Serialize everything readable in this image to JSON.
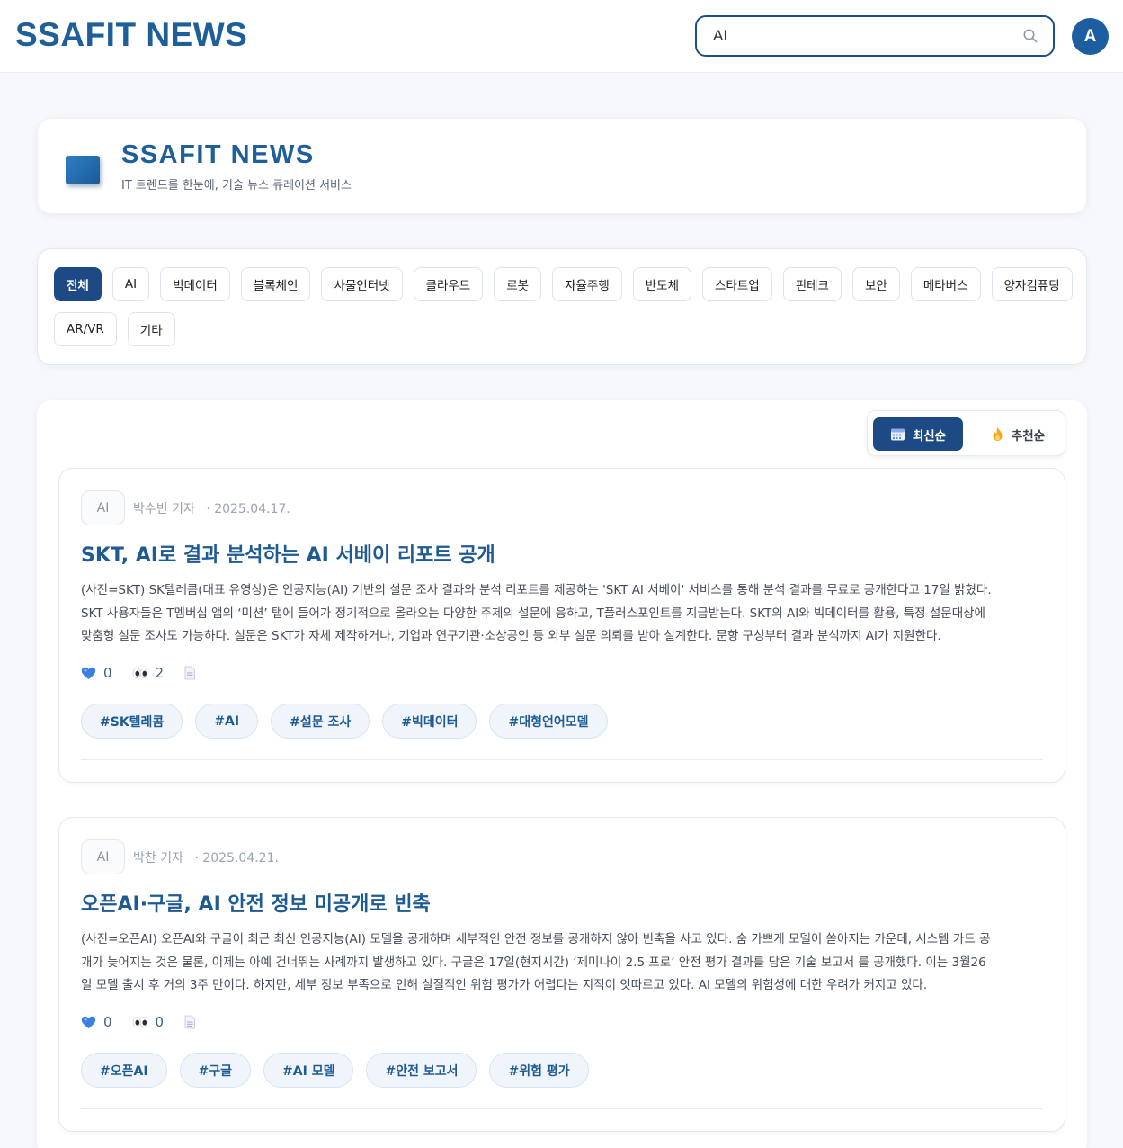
{
  "header": {
    "brand": "SSAFIT NEWS",
    "search_value": "AI",
    "avatar_letter": "A"
  },
  "hero": {
    "title": "SSAFIT NEWS",
    "subtitle": "IT 트렌드를 한눈에, 기술 뉴스 큐레이션 서비스"
  },
  "categories": {
    "items": [
      "전체",
      "AI",
      "빅데이터",
      "블록체인",
      "사물인터넷",
      "클라우드",
      "로봇",
      "자율주행",
      "반도체",
      "스타트업",
      "핀테크",
      "보안",
      "메타버스",
      "양자컴퓨팅",
      "AR/VR",
      "기타"
    ],
    "active": "전체"
  },
  "sort": {
    "latest_label": "최신순",
    "recommend_label": "추천순",
    "active": "최신순"
  },
  "articles": [
    {
      "category": "AI",
      "author": "박수빈 기자",
      "date": "· 2025.04.17.",
      "title": "SKT, AI로 결과 분석하는 AI 서베이 리포트 공개",
      "body": "(사진=SKT) SK텔레콤(대표 유영상)은 인공지능(AI) 기반의 설문 조사 결과와 분석 리포트를 제공하는 'SKT AI 서베이' 서비스를 통해 분석 결과를 무료로 공개한다고 17일 밝혔다. SKT 사용자들은 T멤버십 앱의 ‘미션’ 탭에 들어가 정기적으로 올라오는 다양한 주제의 설문에 응하고, T플러스포인트를 지급받는다. SKT의 AI와 빅데이터를 활용, 특정 설문대상에 맞춤형 설문 조사도 가능하다. 설문은 SKT가 자체 제작하거나, 기업과 연구기관·소상공인 등 외부 설문 의뢰를 받아 설계한다. 문항 구성부터 결과 분석까지 AI가 지원한다.",
      "likes": "0",
      "views": "2",
      "tags": [
        "#SK텔레콤",
        "#AI",
        "#설문 조사",
        "#빅데이터",
        "#대형언어모델"
      ]
    },
    {
      "category": "AI",
      "author": "박찬 기자",
      "date": "· 2025.04.21.",
      "title": "오픈AI·구글, AI 안전 정보 미공개로 빈축",
      "body": "(사진=오픈AI) 오픈AI와 구글이 최근 최신 인공지능(AI) 모델을 공개하며 세부적인 안전 정보를 공개하지 않아 빈축을 사고 있다. 숨 가쁘게 모델이 쏟아지는 가운데, 시스템 카드 공개가 늦어지는 것은 물론, 이제는 아예 건너뛰는 사례까지 발생하고 있다. 구글은 17일(현지시간) ‘제미나이 2.5 프로’ 안전 평가 결과를 담은 기술 보고서 를 공개했다. 이는 3월26일 모델 출시 후 거의 3주 만이다. 하지만, 세부 정보 부족으로 인해 실질적인 위험 평가가 어렵다는 지적이 잇따르고 있다. AI 모델의 위험성에 대한 우려가 커지고 있다.",
      "likes": "0",
      "views": "0",
      "tags": [
        "#오픈AI",
        "#구글",
        "#AI 모델",
        "#안전 보고서",
        "#위험 평가"
      ]
    }
  ],
  "icons": {
    "search": "search-icon",
    "like": "blue-heart-icon",
    "views": "eyes-icon",
    "document": "document-icon",
    "calendar": "calendar-icon",
    "fire": "fire-icon"
  },
  "colors": {
    "brand": "#1e5f99",
    "accent_dark": "#1d4a85",
    "tag_bg": "#f0f5fb"
  }
}
